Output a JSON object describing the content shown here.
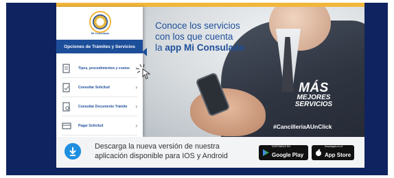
{
  "logo": {
    "text": "Mi Consulado"
  },
  "panel": {
    "header": "Opciones de Trámites y Servicios",
    "items": [
      {
        "label": "Tipos, procedimientos y costos",
        "icon": "document-list-icon"
      },
      {
        "label": "Consultar Solicitud",
        "icon": "document-check-icon"
      },
      {
        "label": "Consultar Documento Trámite",
        "icon": "document-search-icon"
      },
      {
        "label": "Pagar Solicitud",
        "icon": "payment-icon"
      }
    ],
    "chevron": "›"
  },
  "headline": {
    "line1": "Conoce los servicios",
    "line2": "con los que cuenta",
    "line3_prefix": "la ",
    "line3_strong": "app Mi Consulado"
  },
  "promo": {
    "line1": "MÁS",
    "line2": "MEJORES",
    "line3": "SERVICIOS",
    "hashtag": "#CancilleríaAUnClick"
  },
  "download": {
    "text": "Descarga la nueva versión de nuestra aplicación disponible para IOS y Android",
    "google_play_small": "DISPONIBLE EN",
    "google_play_big": "Google Play",
    "app_store_small": "Descárgalo en el",
    "app_store_big": "App Store"
  },
  "colors": {
    "navy": "#0f2360",
    "blue": "#1d4e9a",
    "gold": "#f2b63a",
    "accent": "#1f8fe0"
  }
}
